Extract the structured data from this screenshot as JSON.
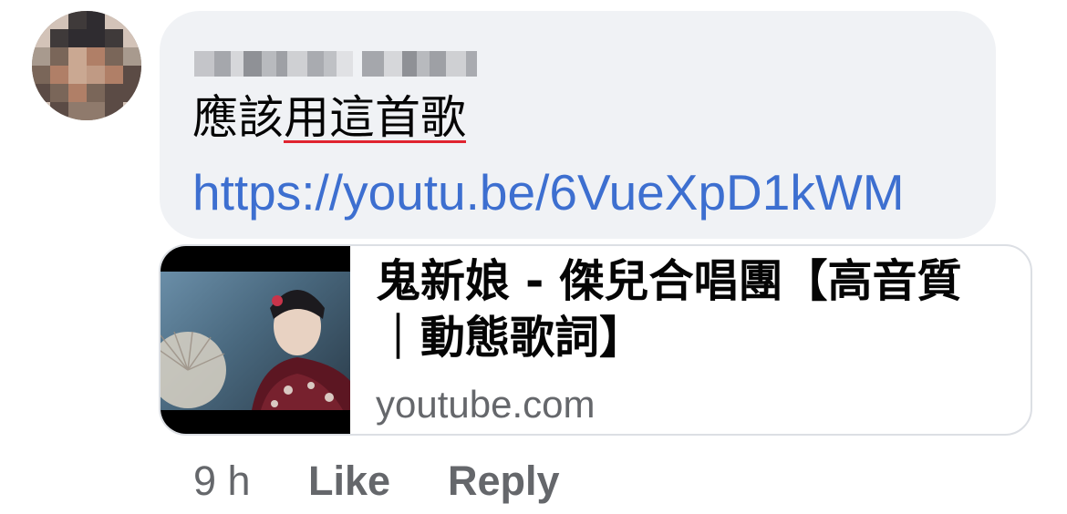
{
  "comment": {
    "author_name_obscured": "author name (pixelated)",
    "text_plain": "應該",
    "text_underlined": "用這首歌",
    "link": "https://youtu.be/6VueXpD1kWM"
  },
  "link_preview": {
    "title": "鬼新娘 - 傑兒合唱團【高音質｜動態歌詞】",
    "domain": "youtube.com"
  },
  "actions": {
    "timestamp": "9 h",
    "like_label": "Like",
    "reply_label": "Reply"
  },
  "colors": {
    "bubble_bg": "#f0f2f5",
    "link": "#3d6fd0",
    "meta_text": "#65676b",
    "spellcheck_underline": "#e0242f"
  },
  "icons": {
    "avatar": "pixelated-profile-photo",
    "thumbnail": "video-thumbnail"
  }
}
